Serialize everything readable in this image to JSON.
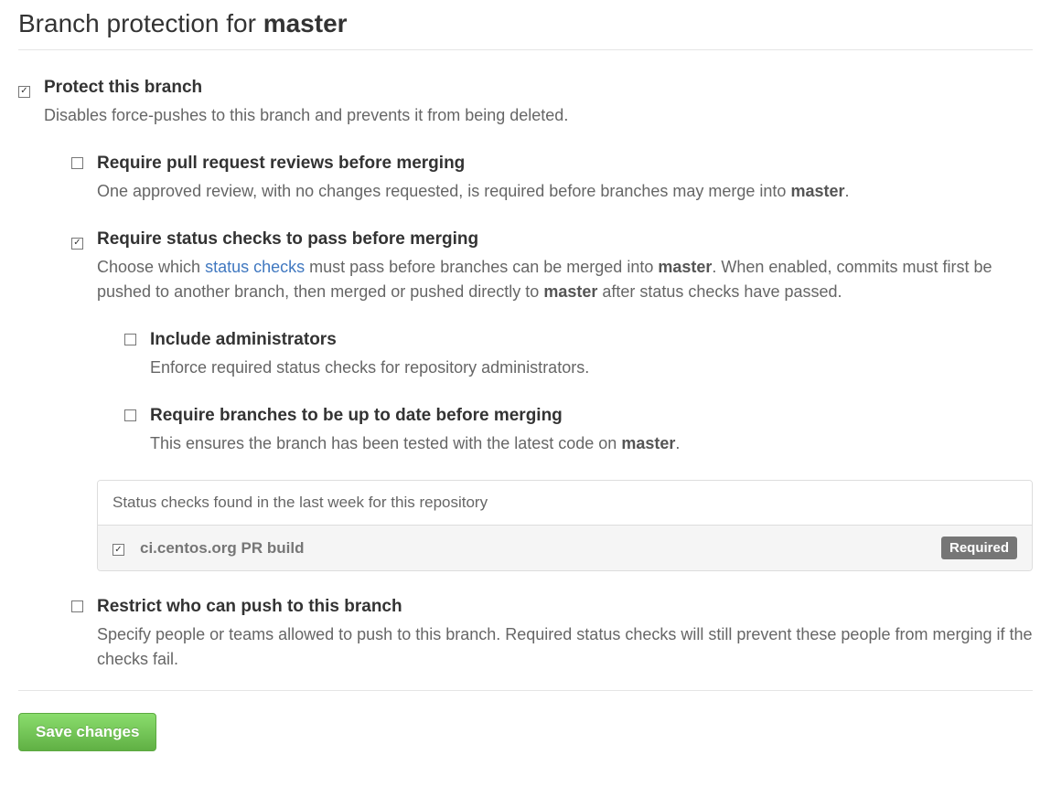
{
  "page": {
    "title_prefix": "Branch protection for ",
    "branch_name": "master"
  },
  "protect": {
    "checked": true,
    "label": "Protect this branch",
    "description": "Disables force-pushes to this branch and prevents it from being deleted."
  },
  "require_reviews": {
    "checked": false,
    "label": "Require pull request reviews before merging",
    "desc_pre": "One approved review, with no changes requested, is required before branches may merge into ",
    "desc_branch": "master",
    "desc_post": "."
  },
  "require_status": {
    "checked": true,
    "label": "Require status checks to pass before merging",
    "desc_pre": "Choose which ",
    "desc_link": "status checks",
    "desc_mid1": " must pass before branches can be merged into ",
    "desc_branch1": "master",
    "desc_mid2": ". When enabled, commits must first be pushed to another branch, then merged or pushed directly to ",
    "desc_branch2": "master",
    "desc_post": " after status checks have passed."
  },
  "include_admins": {
    "checked": false,
    "label": "Include administrators",
    "description": "Enforce required status checks for repository administrators."
  },
  "up_to_date": {
    "checked": false,
    "label": "Require branches to be up to date before merging",
    "desc_pre": "This ensures the branch has been tested with the latest code on ",
    "desc_branch": "master",
    "desc_post": "."
  },
  "status_checks_box": {
    "header": "Status checks found in the last week for this repository",
    "items": [
      {
        "checked": true,
        "name": "ci.centos.org PR build",
        "badge": "Required"
      }
    ]
  },
  "restrict_push": {
    "checked": false,
    "label": "Restrict who can push to this branch",
    "description": "Specify people or teams allowed to push to this branch. Required status checks will still prevent these people from merging if the checks fail."
  },
  "actions": {
    "save_label": "Save changes"
  }
}
